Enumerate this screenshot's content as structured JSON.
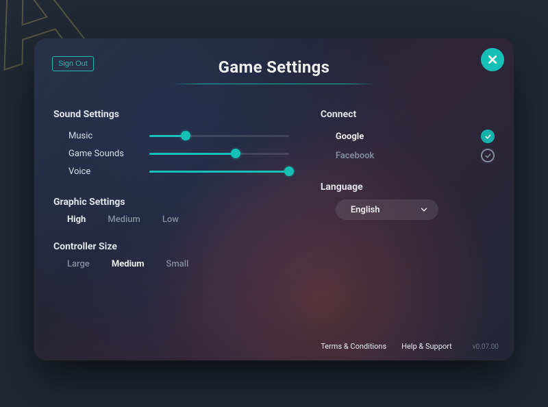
{
  "header": {
    "title": "Game Settings",
    "sign_out": "Sign Out"
  },
  "sound": {
    "heading": "Sound Settings",
    "items": [
      {
        "label": "Music",
        "value": 26
      },
      {
        "label": "Game Sounds",
        "value": 62
      },
      {
        "label": "Voice",
        "value": 100
      }
    ]
  },
  "graphic": {
    "heading": "Graphic Settings",
    "options": [
      "High",
      "Medium",
      "Low"
    ],
    "selected": "High"
  },
  "controller": {
    "heading": "Controller Size",
    "options": [
      "Large",
      "Medium",
      "Small"
    ],
    "selected": "Medium"
  },
  "connect": {
    "heading": "Connect",
    "items": [
      {
        "label": "Google",
        "connected": true
      },
      {
        "label": "Facebook",
        "connected": false
      }
    ]
  },
  "language": {
    "heading": "Language",
    "selected": "English"
  },
  "footer": {
    "terms": "Terms & Conditions",
    "help": "Help & Support",
    "version": "v0.07.00"
  },
  "colors": {
    "accent": "#17c0b7",
    "bg": "#222934",
    "muted": "#8d97a6"
  }
}
